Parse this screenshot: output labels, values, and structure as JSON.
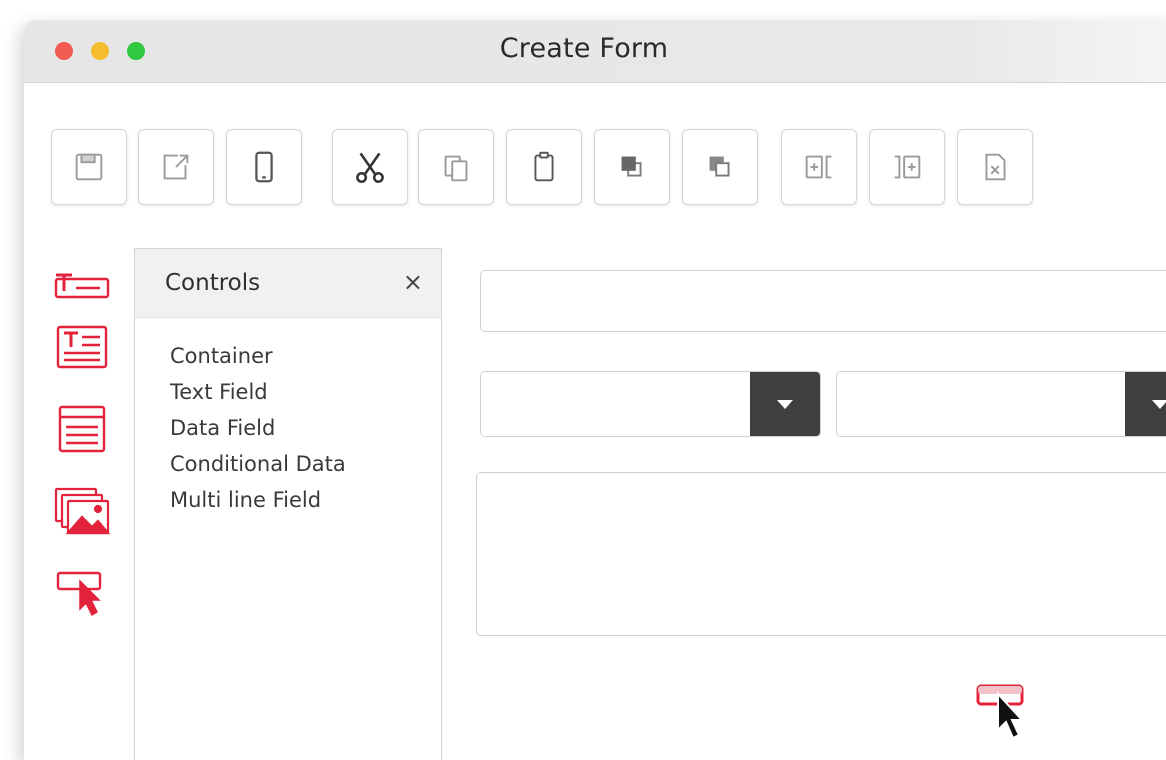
{
  "window": {
    "title": "Create Form",
    "traffic_lights": {
      "close": "#f25b54",
      "minimize": "#f6be2f",
      "maximize": "#2fc840"
    }
  },
  "toolbar": {
    "buttons": [
      {
        "name": "save",
        "icon": "save-icon"
      },
      {
        "name": "export",
        "icon": "export-icon"
      },
      {
        "name": "mobile-preview",
        "icon": "mobile-icon"
      },
      {
        "name": "cut",
        "icon": "scissors-icon"
      },
      {
        "name": "copy",
        "icon": "copy-icon"
      },
      {
        "name": "paste",
        "icon": "clipboard-icon"
      },
      {
        "name": "bring-forward",
        "icon": "bring-forward-icon"
      },
      {
        "name": "send-backward",
        "icon": "send-backward-icon"
      },
      {
        "name": "insert-before",
        "icon": "insert-before-icon"
      },
      {
        "name": "insert-after",
        "icon": "insert-after-icon"
      },
      {
        "name": "delete",
        "icon": "delete-icon"
      }
    ]
  },
  "left_rail": {
    "accent_color": "#e2233b",
    "items": [
      {
        "name": "text-field-tool",
        "icon": "text-field-icon"
      },
      {
        "name": "text-block-tool",
        "icon": "text-block-icon"
      },
      {
        "name": "container-tool",
        "icon": "container-icon"
      },
      {
        "name": "image-tool",
        "icon": "image-gallery-icon"
      },
      {
        "name": "button-tool",
        "icon": "button-cursor-icon"
      }
    ]
  },
  "controls_panel": {
    "title": "Controls",
    "close_label": "×",
    "items": [
      "Container",
      "Text Field",
      "Data Field",
      "Conditional Data",
      "Multi line Field"
    ]
  },
  "canvas": {
    "input_value": "",
    "select1_value": "",
    "select2_value": "",
    "textarea_value": ""
  }
}
